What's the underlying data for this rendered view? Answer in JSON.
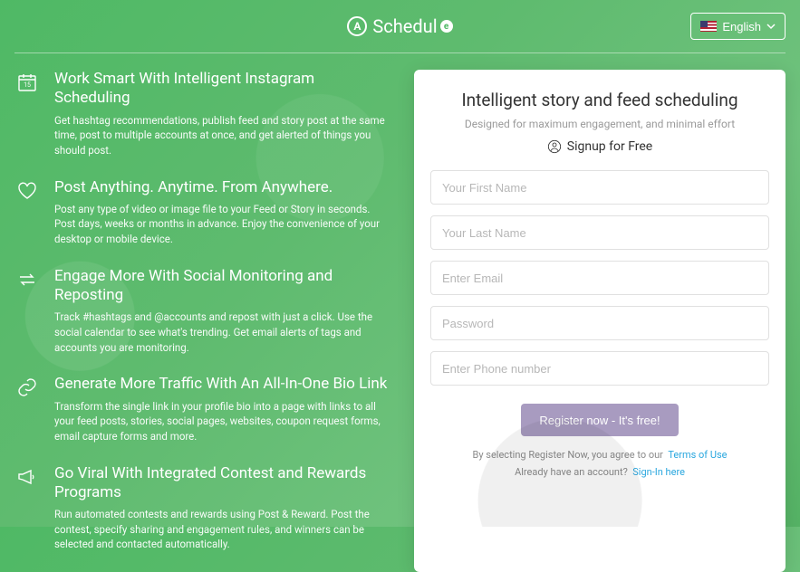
{
  "header": {
    "brand_a": "A",
    "brand_text": "Schedul",
    "brand_e": "e",
    "lang_label": "English"
  },
  "features": [
    {
      "title": "Work Smart With Intelligent Instagram Scheduling",
      "desc": "Get hashtag recommendations, publish feed and story post at the same time, post to multiple accounts at once, and get alerted of things you should post."
    },
    {
      "title": "Post Anything. Anytime. From Anywhere.",
      "desc": "Post any type of video or image file to your Feed or Story in seconds. Post days, weeks or months in advance. Enjoy the convenience of your desktop or mobile device."
    },
    {
      "title": "Engage More With Social Monitoring and Reposting",
      "desc": "Track #hashtags and @accounts and repost with just a click. Use the social calendar to see what's trending. Get email alerts of tags and accounts you are monitoring."
    },
    {
      "title": "Generate More Traffic With An All-In-One Bio Link",
      "desc": "Transform the single link in your profile bio into a page with links to all your feed posts, stories, social pages, websites, coupon request forms, email capture forms and more."
    },
    {
      "title": "Go Viral With Integrated Contest and Rewards Programs",
      "desc": "Run automated contests and rewards using Post & Reward. Post the contest, specify sharing and engagement rules, and winners can be selected and contacted automatically."
    }
  ],
  "calendar_day": "15",
  "card": {
    "title": "Intelligent story and feed scheduling",
    "subtitle": "Designed for maximum engagement, and minimal effort",
    "signup_free": "Signup for Free",
    "placeholders": {
      "first": "Your First Name",
      "last": "Your Last Name",
      "email": "Enter Email",
      "password": "Password",
      "phone": "Enter Phone number"
    },
    "register_label": "Register now - It's free!",
    "agree_prefix": "By selecting Register Now, you agree to our",
    "terms_label": "Terms of Use",
    "already_prefix": "Already have an account?",
    "signin_label": "Sign-In here"
  }
}
